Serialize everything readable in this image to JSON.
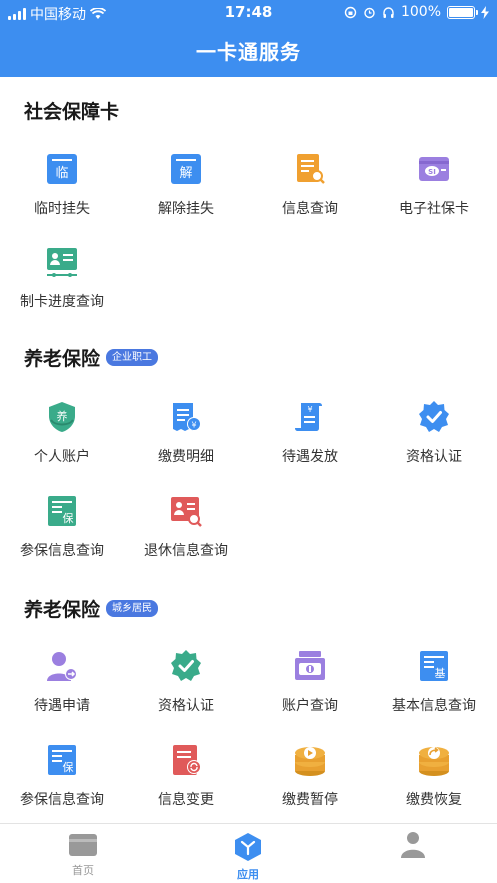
{
  "status_bar": {
    "carrier": "中国移动",
    "time": "17:48",
    "battery": "100%",
    "battery_level": 1.0
  },
  "header": {
    "title": "一卡通服务"
  },
  "sections": [
    {
      "title": "社会保障卡",
      "tag": "",
      "items": [
        {
          "label": "临时挂失",
          "icon": "temporary-report-loss-icon",
          "glyph": "临",
          "color": "#3d8ef0"
        },
        {
          "label": "解除挂失",
          "icon": "cancel-report-loss-icon",
          "glyph": "解",
          "color": "#3d8ef0"
        },
        {
          "label": "信息查询",
          "icon": "info-query-icon",
          "color": "#f0a030"
        },
        {
          "label": "电子社保卡",
          "icon": "electronic-social-card-icon",
          "color": "#9b7fe0"
        },
        {
          "label": "制卡进度查询",
          "icon": "card-progress-icon",
          "color": "#3aab8a"
        }
      ]
    },
    {
      "title": "养老保险",
      "tag": "企业职工",
      "items": [
        {
          "label": "个人账户",
          "icon": "personal-account-shield-icon",
          "glyph": "养",
          "color": "#3aab8a"
        },
        {
          "label": "缴费明细",
          "icon": "payment-details-icon",
          "color": "#3d8ef0"
        },
        {
          "label": "待遇发放",
          "icon": "benefit-scroll-icon",
          "color": "#3d8ef0"
        },
        {
          "label": "资格认证",
          "icon": "qualification-badge-icon",
          "color": "#3d8ef0"
        },
        {
          "label": "参保信息查询",
          "icon": "insured-info-icon",
          "glyph": "保",
          "color": "#3aab8a"
        },
        {
          "label": "退休信息查询",
          "icon": "retirement-info-icon",
          "color": "#e05a5a"
        }
      ]
    },
    {
      "title": "养老保险",
      "tag": "城乡居民",
      "items": [
        {
          "label": "待遇申请",
          "icon": "benefit-application-icon",
          "color": "#9b7fe0"
        },
        {
          "label": "资格认证",
          "icon": "qualification-badge-icon",
          "color": "#3aab8a"
        },
        {
          "label": "账户查询",
          "icon": "account-query-icon",
          "color": "#9b7fe0"
        },
        {
          "label": "基本信息查询",
          "icon": "basic-info-icon",
          "glyph": "基",
          "color": "#3d8ef0"
        },
        {
          "label": "参保信息查询",
          "icon": "insured-info-icon",
          "glyph": "保",
          "color": "#3d8ef0"
        },
        {
          "label": "信息变更",
          "icon": "info-change-icon",
          "color": "#e05a5a"
        },
        {
          "label": "缴费暂停",
          "icon": "payment-pause-icon",
          "color": "#e8a030"
        },
        {
          "label": "缴费恢复",
          "icon": "payment-resume-icon",
          "color": "#e8a030"
        }
      ]
    }
  ],
  "tabbar": {
    "tabs": [
      {
        "label": "首页",
        "icon": "home-card-icon"
      },
      {
        "label": "应用",
        "icon": "apps-icon"
      },
      {
        "label": "",
        "icon": "profile-icon"
      }
    ]
  }
}
